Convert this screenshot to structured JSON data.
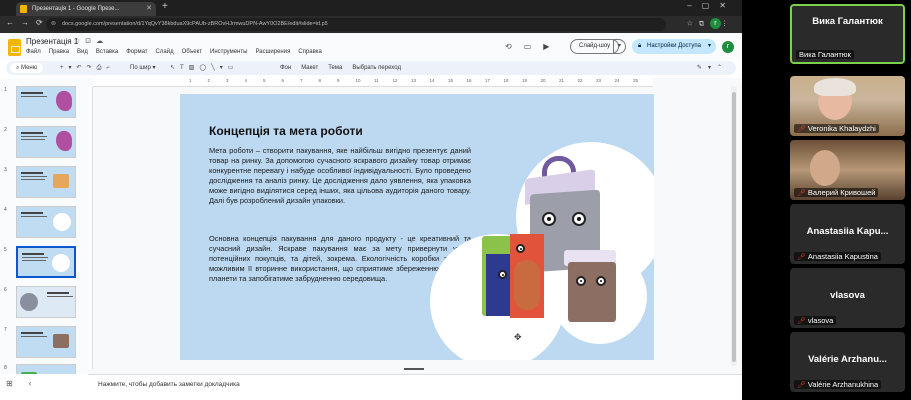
{
  "browser": {
    "tab_title": "Презентація 1 - Google Презе...",
    "url": "docs.google.com/presentation/d/1YqQvY38kbduaX9cPAUb-zBROvHJrmwuDPN-AwY0O2BE/edit#slide=id.p5",
    "account_initial": "г"
  },
  "app": {
    "doc_title": "Презентація 1",
    "menus": [
      "Файл",
      "Правка",
      "Вид",
      "Вставка",
      "Формат",
      "Слайд",
      "Объект",
      "Инструменты",
      "Расширения",
      "Справка"
    ],
    "slideshow_label": "Слайд-шоу",
    "share_label": "Настройки Доступа",
    "account_initial": "г"
  },
  "toolbar": {
    "menu_label": "Меню",
    "zoom_label": "По шир",
    "text_buttons": [
      "Фон",
      "Макет",
      "Тема",
      "Выбрать переход"
    ]
  },
  "ruler": {
    "ticks": [
      "1",
      "2",
      "3",
      "4",
      "5",
      "6",
      "7",
      "8",
      "9",
      "10",
      "11",
      "12",
      "13",
      "14",
      "15",
      "16",
      "17",
      "18",
      "19",
      "20",
      "21",
      "22",
      "23",
      "24",
      "25"
    ]
  },
  "filmstrip": {
    "slides": [
      {
        "num": "1"
      },
      {
        "num": "2"
      },
      {
        "num": "3"
      },
      {
        "num": "4"
      },
      {
        "num": "5",
        "selected": true
      },
      {
        "num": "6"
      },
      {
        "num": "7"
      },
      {
        "num": "8"
      }
    ]
  },
  "slide": {
    "title": "Концепція та мета роботи",
    "paragraph1": "Мета роботи – створити пакування, яке найбільш вигідно презентує даний товар на ринку. За допомогою сучасного яскравого дизайну товар отримає конкурентне перевагу і набуде особливої індивідуальності. Було проведено дослідження та аналіз ринку. Це дослідження дало уявлення, яка упаковка може вигідно виділятися серед інших, яка цільова аудиторія даного товару. Далі був розроблений дизайн упаковки.",
    "paragraph2": "Основна концепція пакування для даного продукту - це креативний та сучасний дизайн. Яскраве пакування має за мету привернути увагу потенційних покупців, та дітей, зокрема. Екологічність коробки зробить можливим її вторинне використання, що сприятиме збереженню ресурсів планети та запобігатиме забрудненню середовища."
  },
  "notes": {
    "placeholder": "Нажмите, чтобы добавить заметки докладчика"
  },
  "participants": [
    {
      "big_name": "Вика Галантюк",
      "small_name": "Вика Галантюк",
      "active": true,
      "video": false,
      "muted": false
    },
    {
      "big_name": "",
      "small_name": "Veronika Khalaydzhi",
      "active": false,
      "video": true,
      "muted": true
    },
    {
      "big_name": "",
      "small_name": "Валерий Кривошей",
      "active": false,
      "video": true,
      "muted": true
    },
    {
      "big_name": "Anastasiia Kapu...",
      "small_name": "Anastasiia Kapustina",
      "active": false,
      "video": false,
      "muted": true
    },
    {
      "big_name": "vlasova",
      "small_name": "vlasova",
      "active": false,
      "video": false,
      "muted": true
    },
    {
      "big_name": "Valérie Arzhanu...",
      "small_name": "Valérie Arzhanukhina",
      "active": false,
      "video": false,
      "muted": true
    }
  ]
}
